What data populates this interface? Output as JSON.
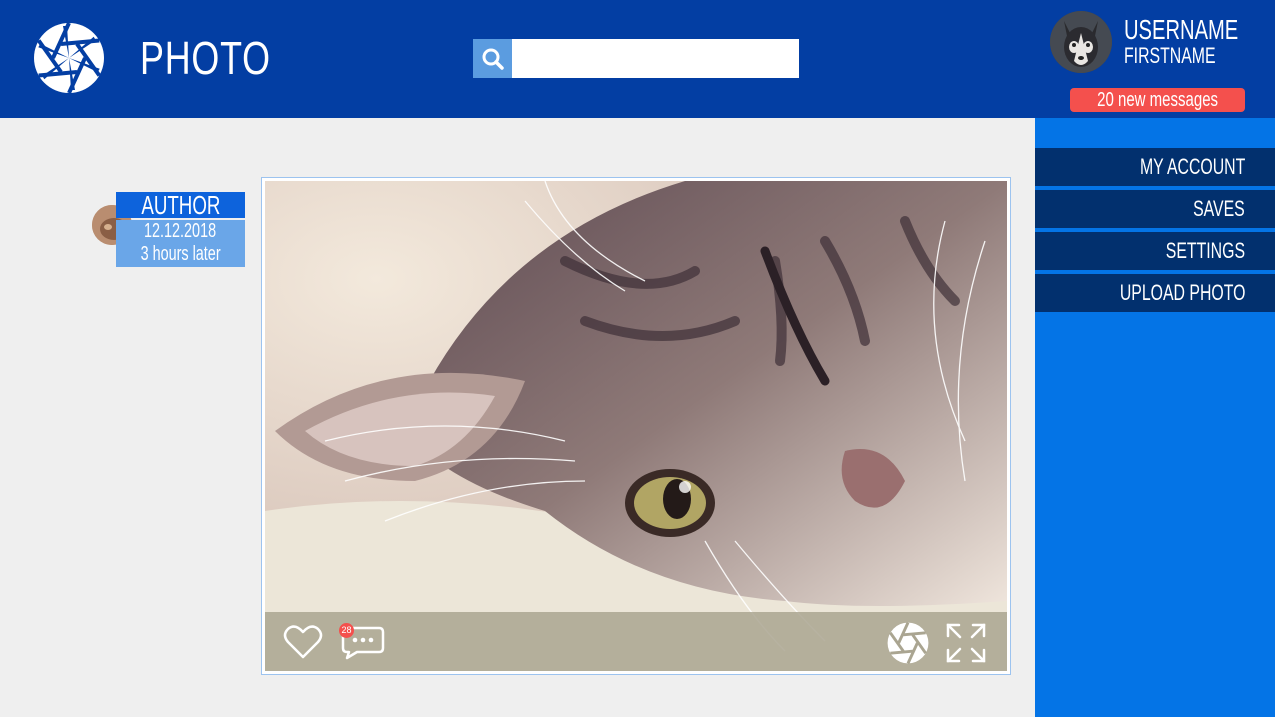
{
  "header": {
    "app_title": "PHOTO",
    "logo_icon": "aperture-icon",
    "search": {
      "icon": "search-icon",
      "placeholder": "",
      "value": ""
    }
  },
  "user": {
    "username": "USERNAME",
    "firstname": "FIRSTNAME",
    "messages_label": "20 new messages",
    "avatar": "husky-avatar"
  },
  "menu": {
    "items": [
      {
        "label": "MY ACCOUNT"
      },
      {
        "label": "SAVES"
      },
      {
        "label": "SETTINGS"
      },
      {
        "label": "UPLOAD PHOTO"
      }
    ]
  },
  "post": {
    "author_label": "AUTHOR",
    "date": "12.12.2018",
    "time_ago": "3 hours later",
    "photo_subject": "cat-photo",
    "comment_count": "28",
    "actions": [
      "heart-icon",
      "comment-icon",
      "aperture-icon",
      "expand-icon"
    ]
  },
  "colors": {
    "header_bg": "#033ea3",
    "panel_bg": "#0474e6",
    "menu_bg": "#02306e",
    "accent_red": "#f4504d",
    "page_bg": "#efefef"
  }
}
